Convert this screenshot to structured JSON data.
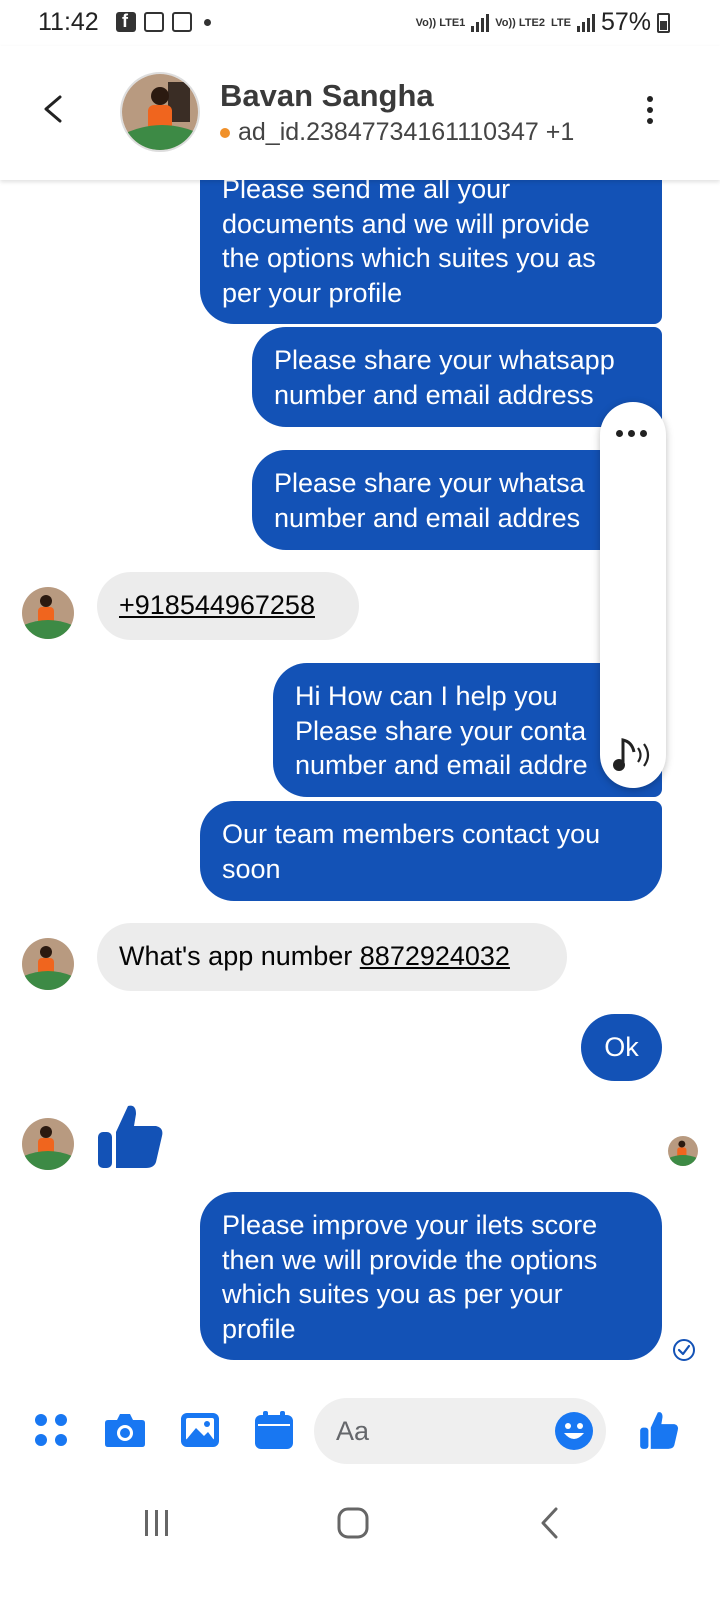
{
  "status_bar": {
    "time": "11:42",
    "battery": "57%",
    "sim1": "Vo)) LTE1",
    "sim2": "Vo)) LTE2",
    "net": "LTE"
  },
  "header": {
    "contact_name": "Bavan Sangha",
    "subtitle": "ad_id.23847734161110347 +1",
    "status_dot_color": "#f0902a"
  },
  "colors": {
    "outgoing_bubble": "#1352b6",
    "incoming_bubble": "#ececec",
    "messenger_blue": "#1877f2"
  },
  "messages": [
    {
      "direction": "out",
      "text": [
        "Please send me all your",
        "documents and we will provide",
        "the options which suites you as",
        "per your profile"
      ]
    },
    {
      "direction": "out",
      "text": [
        "Please share your whatsapp",
        "number and email address"
      ]
    },
    {
      "direction": "out",
      "text": [
        "Please share your whatsa",
        "number and email addres"
      ]
    },
    {
      "direction": "in",
      "text": [
        "+918544967258"
      ]
    },
    {
      "direction": "out",
      "text": [
        "Hi How can I help you",
        "Please share your conta",
        "number and email addre"
      ]
    },
    {
      "direction": "out",
      "text": [
        "Our team members contact you",
        "soon"
      ]
    },
    {
      "direction": "in",
      "text_prefix": "What's app number ",
      "text_link": "8872924032"
    },
    {
      "direction": "out",
      "text": [
        "Ok"
      ]
    },
    {
      "direction": "in",
      "type": "like-sticker"
    },
    {
      "direction": "out",
      "text": [
        "Please improve your ilets score",
        "then we will provide the options",
        "which suites you as per your",
        "profile"
      ],
      "status": "delivered"
    }
  ],
  "composer": {
    "placeholder": "Aa"
  },
  "icons": {
    "back": "chevron-left-icon",
    "more": "kebab-menu-icon",
    "apps": "four-dots-icon",
    "camera": "camera-icon",
    "gallery": "image-icon",
    "calendar": "calendar-icon",
    "emoji": "smiley-icon",
    "like": "thumbs-up-icon",
    "audio": "music-note-icon"
  }
}
